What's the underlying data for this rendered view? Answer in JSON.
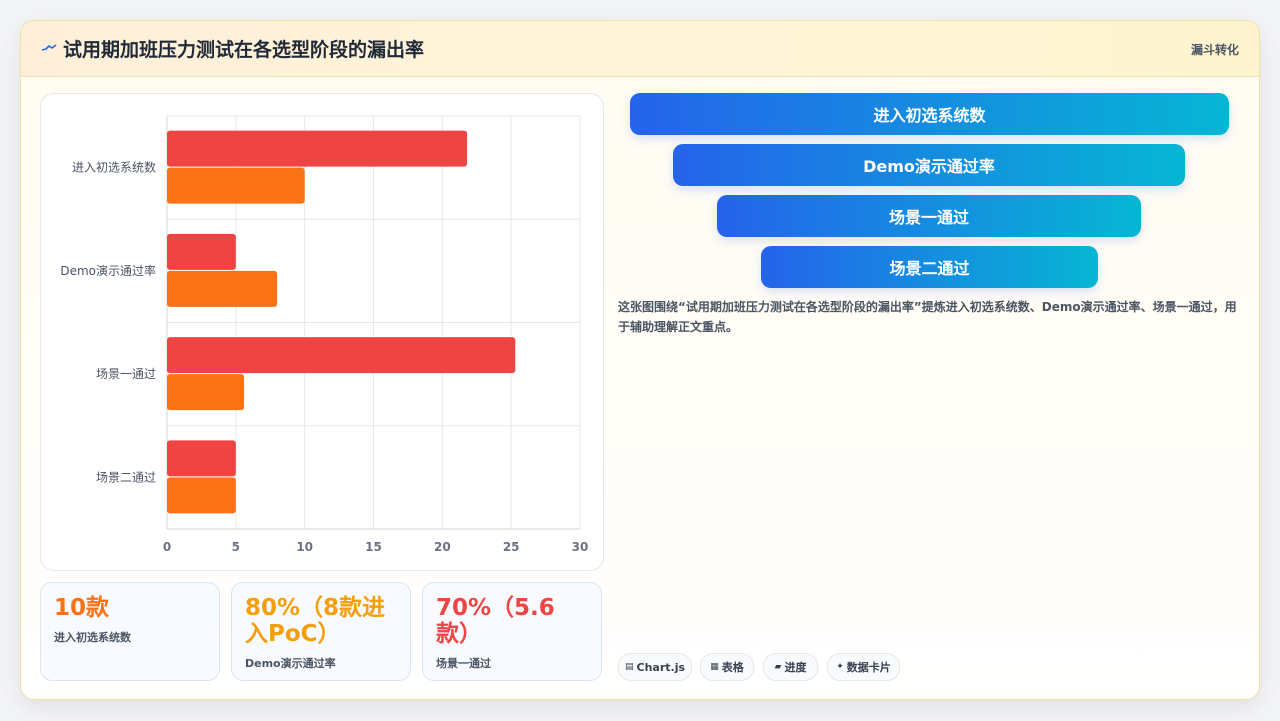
{
  "header": {
    "title": "试用期加班压力测试在各选型阶段的漏出率",
    "tag": "漏斗转化",
    "icon": "pulse-icon"
  },
  "chart_data": {
    "type": "bar",
    "orientation": "horizontal",
    "categories": [
      "进入初选系统数",
      "Demo演示通过率",
      "场景一通过",
      "场景二通过"
    ],
    "series": [
      {
        "color": "#ef4444",
        "values": [
          21.8,
          5,
          25.3,
          5
        ]
      },
      {
        "color": "#f97316",
        "values": [
          10,
          8,
          5.6,
          5
        ]
      }
    ],
    "xlim": [
      0,
      30
    ],
    "xticks": [
      0,
      5,
      10,
      15,
      20,
      25,
      30
    ],
    "grid": true,
    "legend": "none"
  },
  "kpis": [
    {
      "value": "10款",
      "label": "进入初选系统数",
      "color": "#f97316"
    },
    {
      "value": "80%（8款进入PoC）",
      "label": "Demo演示通过率",
      "color": "#f59e0b"
    },
    {
      "value": "70%（5.6款）",
      "label": "场景一通过",
      "color": "#ef4444"
    }
  ],
  "funnel": [
    "进入初选系统数",
    "Demo演示通过率",
    "场景一通过",
    "场景二通过"
  ],
  "description": "这张图围绕“试用期加班压力测试在各选型阶段的漏出率”提炼进入初选系统数、Demo演示通过率、场景一通过，用于辅助理解正文重点。",
  "chips": [
    {
      "icon": "chart-icon",
      "glyph": "▤",
      "label": "Chart.js"
    },
    {
      "icon": "table-icon",
      "glyph": "▦",
      "label": "表格"
    },
    {
      "icon": "progress-icon",
      "glyph": "▰",
      "label": "进度"
    },
    {
      "icon": "sparkle-icon",
      "glyph": "✦",
      "label": "数据卡片"
    }
  ]
}
